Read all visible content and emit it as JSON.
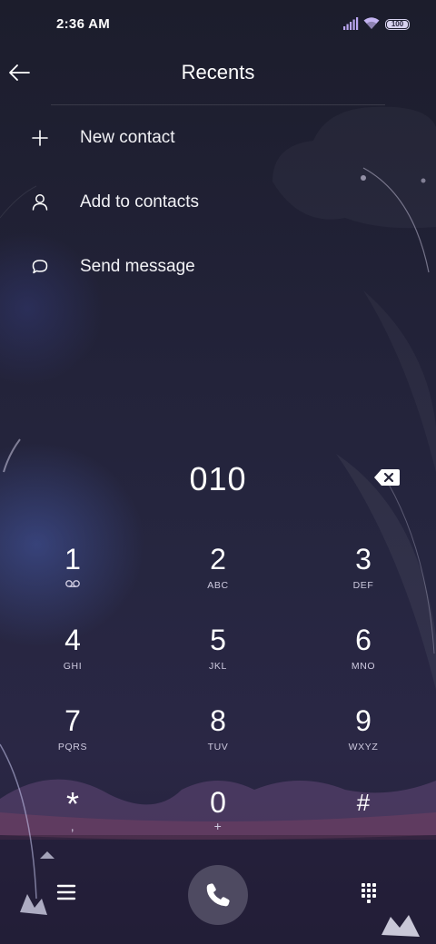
{
  "status_bar": {
    "time": "2:36 AM",
    "battery": "100",
    "icons": [
      "signal-icon",
      "wifi-icon",
      "battery-icon"
    ]
  },
  "header": {
    "back_icon": "arrow-left-icon",
    "title": "Recents"
  },
  "menu": [
    {
      "icon": "plus-icon",
      "label": "New contact"
    },
    {
      "icon": "person-icon",
      "label": "Add to contacts"
    },
    {
      "icon": "chat-bubble-icon",
      "label": "Send message"
    }
  ],
  "dialer": {
    "number": "010",
    "backspace_icon": "backspace-icon",
    "keys": [
      {
        "digit": "1",
        "letters": "",
        "sub_icon": "voicemail-icon"
      },
      {
        "digit": "2",
        "letters": "ABC"
      },
      {
        "digit": "3",
        "letters": "DEF"
      },
      {
        "digit": "4",
        "letters": "GHI"
      },
      {
        "digit": "5",
        "letters": "JKL"
      },
      {
        "digit": "6",
        "letters": "MNO"
      },
      {
        "digit": "7",
        "letters": "PQRS"
      },
      {
        "digit": "8",
        "letters": "TUV"
      },
      {
        "digit": "9",
        "letters": "WXYZ"
      },
      {
        "digit": "*",
        "letters": ","
      },
      {
        "digit": "0",
        "letters": "+"
      },
      {
        "digit": "#",
        "letters": ""
      }
    ]
  },
  "bottom_bar": {
    "menu_icon": "hamburger-menu-icon",
    "call_icon": "phone-icon",
    "keypad_icon": "dialpad-icon"
  },
  "colors": {
    "background": "#1e1d2e",
    "text": "#ffffff",
    "call_button": "#565268"
  }
}
